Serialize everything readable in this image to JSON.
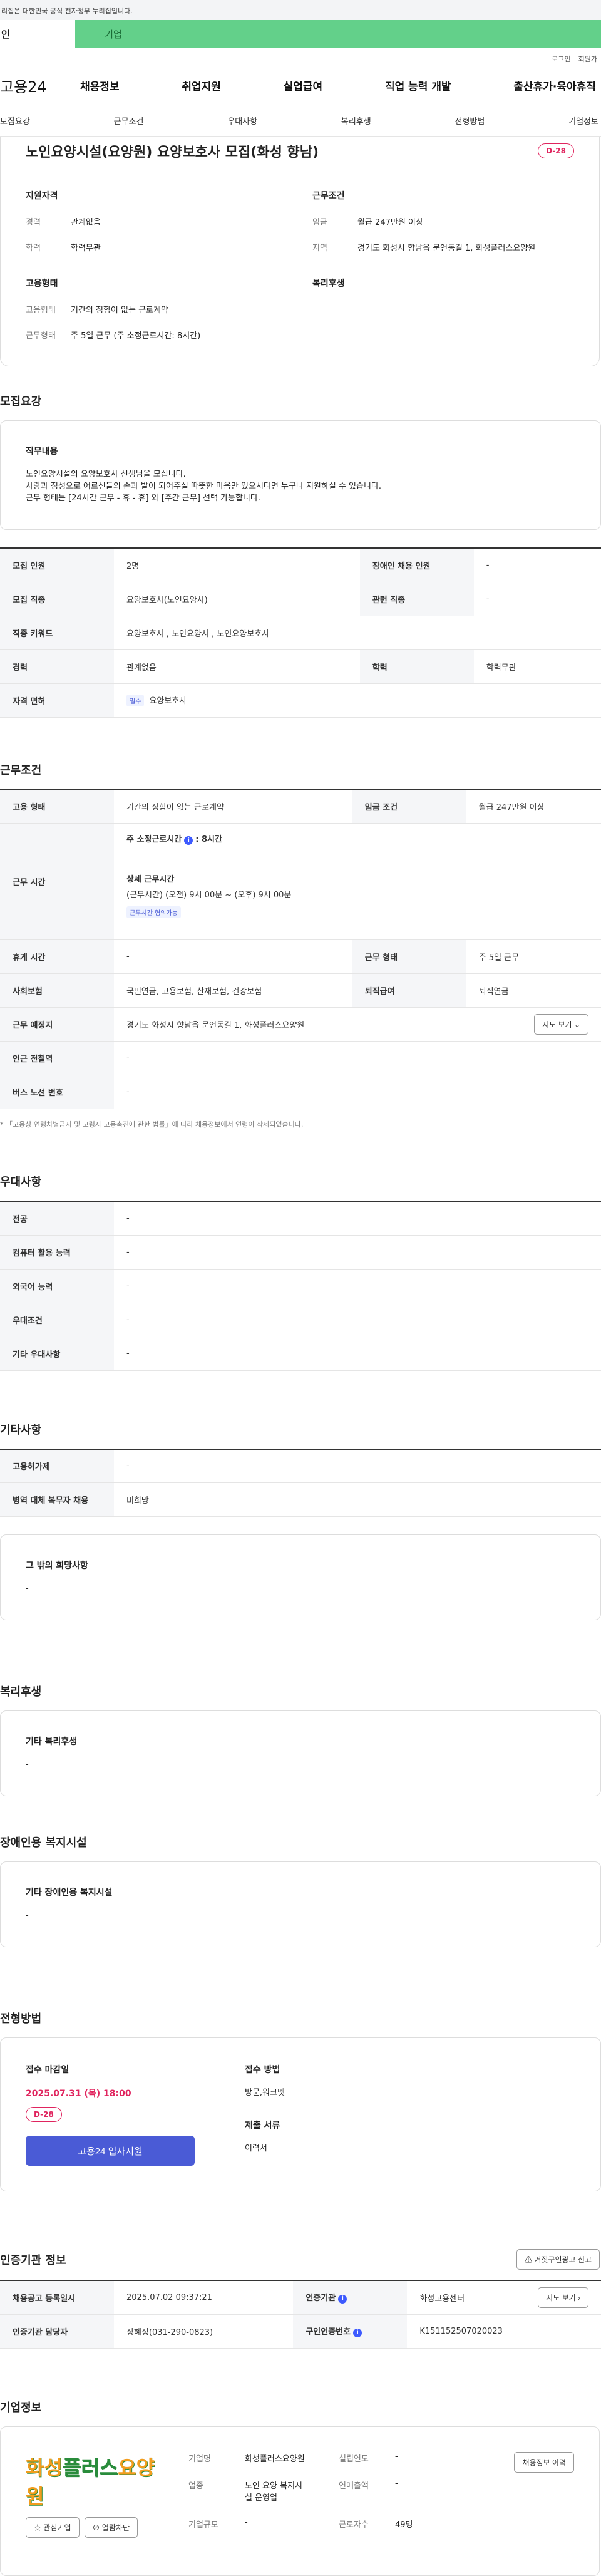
{
  "gov_notice": "리집은 대한민국 공식 전자정부 누리집입니다.",
  "user_tabs": [
    "인",
    "기업"
  ],
  "top_links": [
    "로그인",
    "회원가"
  ],
  "logo": "고용24",
  "gnb": [
    "채용정보",
    "취업지원",
    "실업급여",
    "직업 능력 개발",
    "출산휴가·육아휴직"
  ],
  "subnav": [
    "모집요강",
    "근무조건",
    "우대사항",
    "복리후생",
    "전형방법",
    "기업정보"
  ],
  "job": {
    "title": "노인요양시설(요양원) 요양보호사 모집(화성 향남)",
    "dday": "D-28"
  },
  "summary": {
    "qual_h": "지원자격",
    "exp_k": "경력",
    "exp_v": "관계없음",
    "edu_k": "학력",
    "edu_v": "학력무관",
    "emp_h": "고용형태",
    "type_k": "고용형태",
    "type_v": "기간의 정함이 없는 근로계약",
    "work_k": "근무형태",
    "work_v": "주 5일 근무 (주 소정근로시간: 8시간)",
    "cond_h": "근무조건",
    "pay_k": "임금",
    "pay_v": "월급 247만원 이상",
    "loc_k": "지역",
    "loc_v": "경기도 화성시 향남읍 문언동길 1, 화성플러스요양원",
    "welfare_h": "복리후생"
  },
  "recruit": {
    "title": "모집요강",
    "duty_h": "직무내용",
    "duty_lines": [
      "노인요양시설의 요양보호사 선생님을 모십니다.",
      "사랑과 정성으로 어르신들의 손과 발이 되어주실 따뜻한 마음만 있으시다면 누구나 지원하실 수 있습니다.",
      "근무 형태는 [24시간 근무 - 휴 - 휴] 와 [주간 근무] 선택 가능합니다."
    ],
    "count_k": "모집 인원",
    "count_v": "2명",
    "disabled_k": "장애인 채용 인원",
    "disabled_v": "-",
    "job_k": "모집 직종",
    "job_v": "요양보호사(노인요양사)",
    "related_k": "관련 직종",
    "related_v": "-",
    "kw_k": "직종 키워드",
    "kw_v": "요양보호사 , 노인요양사 , 노인요양보호사",
    "exp_k": "경력",
    "exp_v": "관계없음",
    "edu_k": "학력",
    "edu_v": "학력무관",
    "lic_k": "자격 면허",
    "lic_badge": "필수",
    "lic_v": "요양보호사"
  },
  "conditions": {
    "title": "근무조건",
    "type_k": "고용 형태",
    "type_v": "기간의 정함이 없는 근로계약",
    "pay_k": "임금 조건",
    "pay_v": "월급 247만원 이상",
    "time_k": "근무 시간",
    "week_h": "주 소정근로시간",
    "week_v": ": 8시간",
    "detail_h": "상세 근무시간",
    "detail_v": "(근무시간) (오전) 9시 00분 ~ (오후) 9시 00분",
    "nego": "근무시간 협의가능",
    "rest_k": "휴게 시간",
    "rest_v": "-",
    "form_k": "근무 형태",
    "form_v": "주 5일 근무",
    "ins_k": "사회보험",
    "ins_v": "국민연금, 고용보험, 산재보험, 건강보험",
    "sev_k": "퇴직급여",
    "sev_v": "퇴직연금",
    "place_k": "근무 예정지",
    "place_v": "경기도 화성시 향남읍 문언동길 1, 화성플러스요양원",
    "map_btn": "지도 보기",
    "subway_k": "인근 전철역",
    "subway_v": "-",
    "bus_k": "버스 노선 번호",
    "bus_v": "-",
    "note": "* 「고용상 연령차별금지 및 고령자 고용촉진에 관한 법률」에 따라 채용정보에서 연령이 삭제되었습니다."
  },
  "pref": {
    "title": "우대사항",
    "r": [
      [
        "전공",
        "-"
      ],
      [
        "컴퓨터 활용 능력",
        "-"
      ],
      [
        "외국어 능력",
        "-"
      ],
      [
        "우대조건",
        "-"
      ],
      [
        "기타 우대사항",
        "-"
      ]
    ]
  },
  "etc": {
    "title": "기타사항",
    "r": [
      [
        "고용허가제",
        "-"
      ],
      [
        "병역 대체 복무자 채용",
        "비희망"
      ]
    ],
    "hope_h": "그 밖의 희망사항",
    "hope_v": "-"
  },
  "welfare": {
    "title": "복리후생",
    "h": "기타 복리후생",
    "v": "-"
  },
  "facility": {
    "title": "장애인용 복지시설",
    "h": "기타 장애인용 복지시설",
    "v": "-"
  },
  "apply": {
    "title": "전형방법",
    "deadline_h": "접수 마감일",
    "deadline_v": "2025.07.31 (목) 18:00",
    "dday": "D-28",
    "btn": "고용24 입사지원",
    "method_h": "접수 방법",
    "method_v": "방문,워크넷",
    "doc_h": "제출 서류",
    "doc_v": "이력서"
  },
  "agency": {
    "title": "인증기관 정보",
    "report": "거짓구인광고 신고",
    "reg_k": "채용공고 등록일시",
    "reg_v": "2025.07.02 09:37:21",
    "org_k": "인증기관",
    "org_v": "화성고용센터",
    "map_btn": "지도 보기",
    "mgr_k": "인증기관 담당자",
    "mgr_v": "장혜정(031-290-0823)",
    "num_k": "구인인증번호",
    "num_v": "K151152507020023"
  },
  "company": {
    "title": "기업정보",
    "logo_a": "화성",
    "logo_b": "플러스",
    "logo_c": "요양원",
    "fav": "관심기업",
    "block": "열람차단",
    "name_k": "기업명",
    "name_v": "화성플러스요양원",
    "ind_k": "업종",
    "ind_v1": "노인 요양 복지시",
    "ind_v2": "설 운영업",
    "size_k": "기업규모",
    "size_v": "-",
    "est_k": "설립연도",
    "est_v": "-",
    "sales_k": "연매출액",
    "sales_v": "-",
    "emp_k": "근로자수",
    "emp_v": "49명",
    "info_btn": "채용정보 이력"
  }
}
